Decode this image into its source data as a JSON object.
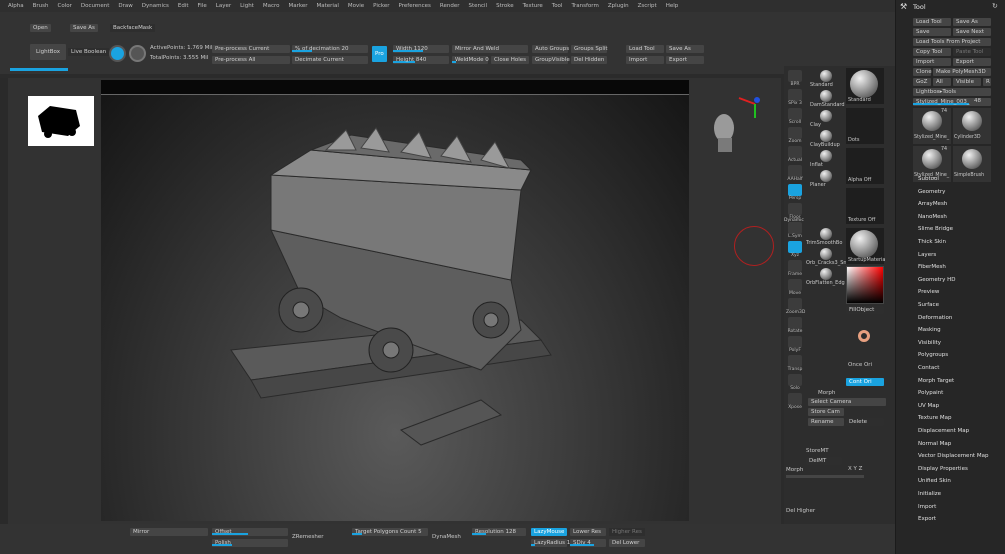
{
  "menu": [
    "Alpha",
    "Brush",
    "Color",
    "Document",
    "Draw",
    "Dynamics",
    "Edit",
    "File",
    "Layer",
    "Light",
    "Macro",
    "Marker",
    "Material",
    "Movie",
    "Picker",
    "Preferences",
    "Render",
    "Stencil",
    "Stroke",
    "Texture",
    "Tool",
    "Transform",
    "Zplugin",
    "Zscript",
    "Help"
  ],
  "top": {
    "open": "Open",
    "save_as": "Save As",
    "backface": "BackfaceMask",
    "lightbox": "LightBox",
    "live_boolean": "Live Boolean",
    "active_points": "ActivePoints: 1.769 Mil",
    "total_points": "TotalPoints: 3.555 Mil",
    "preprocess_current": "Pre-process Current",
    "preprocess_all": "Pre-process All",
    "pct_decimation": "% of decimation 20",
    "decimate_current": "Decimate Current",
    "pro": "Pro",
    "width": "Width 1120",
    "height": "Height 840",
    "mirror_weld": "Mirror And Weld",
    "weld_mode": "WeldMode 0",
    "close_holes": "Close Holes",
    "auto_groups": "Auto Groups",
    "group_visible": "GroupVisible",
    "groups_split": "Groups Split",
    "del_hidden": "Del Hidden",
    "load_tool": "Load Tool",
    "save_as2": "Save As",
    "import": "Import",
    "export": "Export"
  },
  "shelf": {
    "tools": [
      "BPR",
      "SPix 3",
      "Scroll",
      "Zoom",
      "Actual",
      "AAHalf",
      "Persp",
      "Floor",
      "L.Sym",
      "Xyz",
      "Frame",
      "Move",
      "Zoom3D",
      "Rotate",
      "PolyF",
      "Transp",
      "Solo",
      "Xpose"
    ],
    "dynamic": "Dynamic",
    "brushes": [
      "Standard",
      "DamStandard",
      "Clay",
      "ClayBuildup",
      "Inflat",
      "Planer",
      "TrimSmoothBo",
      "Orb_Cracks3_Sn",
      "OrbFlatten_Edg"
    ],
    "standard_big": "Standard",
    "dots": "Dots",
    "alpha_off": "Alpha Off",
    "texture_off": "Texture Off",
    "material": "StartupMateria",
    "fill_object": "FillObject",
    "once_ori": "Once Ori",
    "morph": "Morph",
    "cont_ori": "Cont Ori",
    "select_camera": "Select Camera",
    "store_cam": "Store Cam",
    "rename": "Rename",
    "delete": "Delete",
    "storemt": "StoreMT",
    "delmt": "DelMT",
    "morph_label": "Morph",
    "xyz": "X Y Z",
    "del_higher": "Del Higher"
  },
  "tool_panel": {
    "title": "Tool",
    "load_tool": "Load Tool",
    "save_as": "Save As",
    "save": "Save",
    "save_next": "Save Next",
    "load_from_project": "Load Tools From Project",
    "copy_tool": "Copy Tool",
    "paste_tool": "Paste Tool",
    "import": "Import",
    "export": "Export",
    "clone": "Clone",
    "make_polymesh": "Make PolyMesh3D",
    "goz": "GoZ",
    "all": "All",
    "visible": "Visible",
    "r": "R",
    "lightbox_tools": "Lightbox▸Tools",
    "current_tool": "Stylized_Mine_003_",
    "current_count": "48",
    "thumbs": [
      {
        "name": "Stylized_Mine_",
        "count": "74"
      },
      {
        "name": "Cylinder3D",
        "count": ""
      },
      {
        "name": "Stylized_Mine_",
        "count": "74"
      },
      {
        "name": "SimpleBrush",
        "count": ""
      }
    ],
    "sections": [
      "Subtool",
      "Geometry",
      "ArrayMesh",
      "NanoMesh",
      "Slime Bridge",
      "Thick Skin",
      "Layers",
      "FiberMesh",
      "Geometry HD",
      "Preview",
      "Surface",
      "Deformation",
      "Masking",
      "Visibility",
      "Polygroups",
      "Contact",
      "Morph Target",
      "Polypaint",
      "UV Map",
      "Texture Map",
      "Displacement Map",
      "Normal Map",
      "Vector Displacement Map",
      "Display Properties",
      "Unified Skin",
      "Initialize",
      "Import",
      "Export"
    ]
  },
  "bottom": {
    "mirror": "Mirror",
    "offset": "Offset",
    "polish": "Polish",
    "zremesher": "ZRemesher",
    "target_poly": "Target Polygons Count 5",
    "dynamesh": "DynaMesh",
    "resolution": "Resolution 128",
    "lazymouse": "LazyMouse",
    "lazyradius": "LazyRadius 1",
    "lower_res": "Lower Res",
    "higher_res": "Higher Res",
    "sdiv": "SDiv 4",
    "del_lower": "Del Lower"
  }
}
